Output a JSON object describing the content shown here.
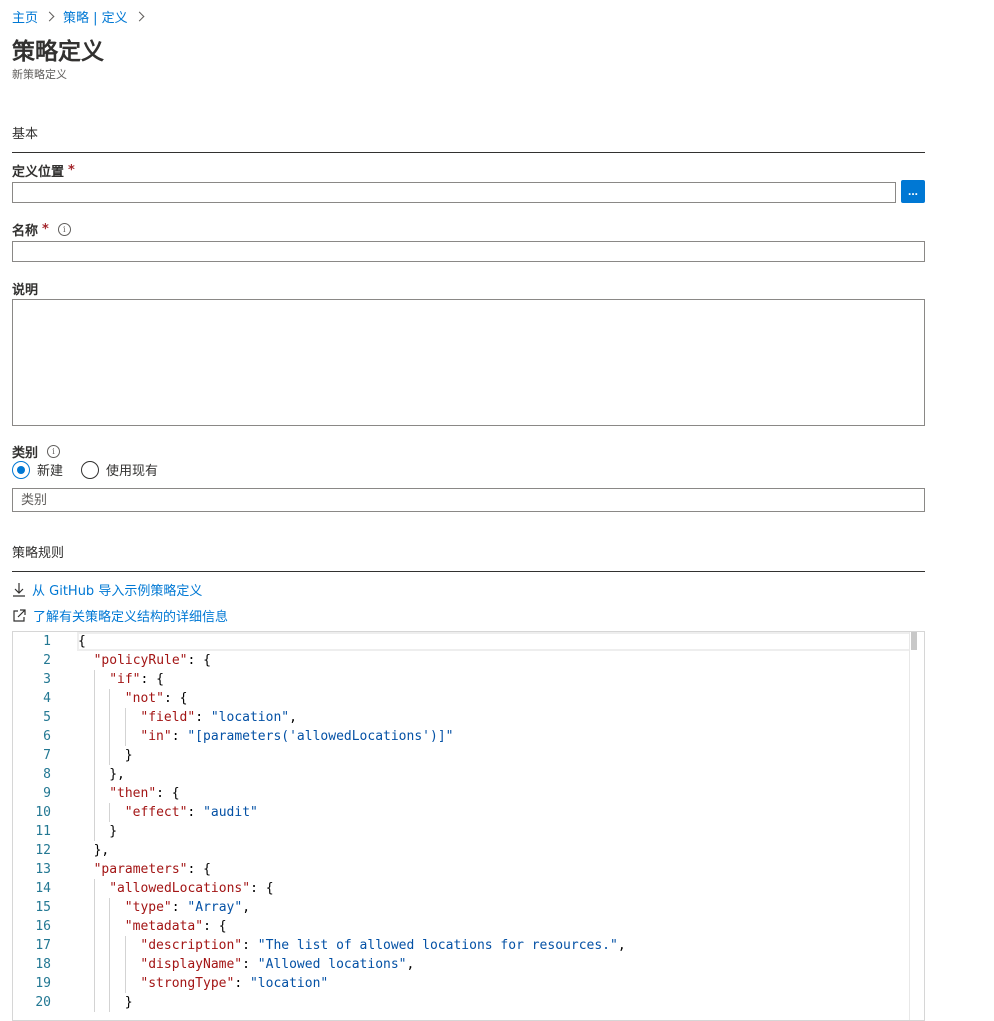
{
  "breadcrumb": {
    "home": "主页",
    "current": "策略 | 定义"
  },
  "header": {
    "title": "策略定义",
    "subtitle": "新策略定义"
  },
  "sections": {
    "basics": "基本",
    "policy_rule": "策略规则"
  },
  "fields": {
    "location": {
      "label": "定义位置",
      "required": "*",
      "value": "",
      "browse_label": "..."
    },
    "name": {
      "label": "名称",
      "required": "*",
      "value": ""
    },
    "description": {
      "label": "说明",
      "value": ""
    },
    "category": {
      "label": "类别",
      "options": [
        "新建",
        "使用现有"
      ],
      "selected": "新建",
      "placeholder": "类别"
    }
  },
  "links": {
    "import_github": "从 GitHub 导入示例策略定义",
    "learn_more": "了解有关策略定义结构的详细信息"
  },
  "icons": {
    "info": "info-icon",
    "download": "download-icon",
    "external_link": "external-link-icon"
  },
  "colors": {
    "accent": "#0078d4",
    "json_key": "#a31515",
    "json_string": "#0451a5",
    "line_number": "#237893"
  },
  "editor": {
    "lines": [
      {
        "n": "1",
        "indent": 0,
        "parts": [
          {
            "t": "p",
            "v": "{"
          }
        ]
      },
      {
        "n": "2",
        "indent": 1,
        "parts": [
          {
            "t": "k",
            "v": "\"policyRule\""
          },
          {
            "t": "p",
            "v": ": {"
          }
        ]
      },
      {
        "n": "3",
        "indent": 2,
        "parts": [
          {
            "t": "k",
            "v": "\"if\""
          },
          {
            "t": "p",
            "v": ": {"
          }
        ]
      },
      {
        "n": "4",
        "indent": 3,
        "parts": [
          {
            "t": "k",
            "v": "\"not\""
          },
          {
            "t": "p",
            "v": ": {"
          }
        ]
      },
      {
        "n": "5",
        "indent": 4,
        "parts": [
          {
            "t": "k",
            "v": "\"field\""
          },
          {
            "t": "p",
            "v": ": "
          },
          {
            "t": "s",
            "v": "\"location\""
          },
          {
            "t": "p",
            "v": ","
          }
        ]
      },
      {
        "n": "6",
        "indent": 4,
        "parts": [
          {
            "t": "k",
            "v": "\"in\""
          },
          {
            "t": "p",
            "v": ": "
          },
          {
            "t": "s",
            "v": "\"[parameters('allowedLocations')]\""
          }
        ]
      },
      {
        "n": "7",
        "indent": 3,
        "parts": [
          {
            "t": "p",
            "v": "}"
          }
        ]
      },
      {
        "n": "8",
        "indent": 2,
        "parts": [
          {
            "t": "p",
            "v": "},"
          }
        ]
      },
      {
        "n": "9",
        "indent": 2,
        "parts": [
          {
            "t": "k",
            "v": "\"then\""
          },
          {
            "t": "p",
            "v": ": {"
          }
        ]
      },
      {
        "n": "10",
        "indent": 3,
        "parts": [
          {
            "t": "k",
            "v": "\"effect\""
          },
          {
            "t": "p",
            "v": ": "
          },
          {
            "t": "s",
            "v": "\"audit\""
          }
        ]
      },
      {
        "n": "11",
        "indent": 2,
        "parts": [
          {
            "t": "p",
            "v": "}"
          }
        ]
      },
      {
        "n": "12",
        "indent": 1,
        "parts": [
          {
            "t": "p",
            "v": "},"
          }
        ]
      },
      {
        "n": "13",
        "indent": 1,
        "parts": [
          {
            "t": "k",
            "v": "\"parameters\""
          },
          {
            "t": "p",
            "v": ": {"
          }
        ]
      },
      {
        "n": "14",
        "indent": 2,
        "parts": [
          {
            "t": "k",
            "v": "\"allowedLocations\""
          },
          {
            "t": "p",
            "v": ": {"
          }
        ]
      },
      {
        "n": "15",
        "indent": 3,
        "parts": [
          {
            "t": "k",
            "v": "\"type\""
          },
          {
            "t": "p",
            "v": ": "
          },
          {
            "t": "s",
            "v": "\"Array\""
          },
          {
            "t": "p",
            "v": ","
          }
        ]
      },
      {
        "n": "16",
        "indent": 3,
        "parts": [
          {
            "t": "k",
            "v": "\"metadata\""
          },
          {
            "t": "p",
            "v": ": {"
          }
        ]
      },
      {
        "n": "17",
        "indent": 4,
        "parts": [
          {
            "t": "k",
            "v": "\"description\""
          },
          {
            "t": "p",
            "v": ": "
          },
          {
            "t": "s",
            "v": "\"The list of allowed locations for resources.\""
          },
          {
            "t": "p",
            "v": ","
          }
        ]
      },
      {
        "n": "18",
        "indent": 4,
        "parts": [
          {
            "t": "k",
            "v": "\"displayName\""
          },
          {
            "t": "p",
            "v": ": "
          },
          {
            "t": "s",
            "v": "\"Allowed locations\""
          },
          {
            "t": "p",
            "v": ","
          }
        ]
      },
      {
        "n": "19",
        "indent": 4,
        "parts": [
          {
            "t": "k",
            "v": "\"strongType\""
          },
          {
            "t": "p",
            "v": ": "
          },
          {
            "t": "s",
            "v": "\"location\""
          }
        ]
      },
      {
        "n": "20",
        "indent": 3,
        "parts": [
          {
            "t": "p",
            "v": "}"
          }
        ]
      }
    ]
  }
}
